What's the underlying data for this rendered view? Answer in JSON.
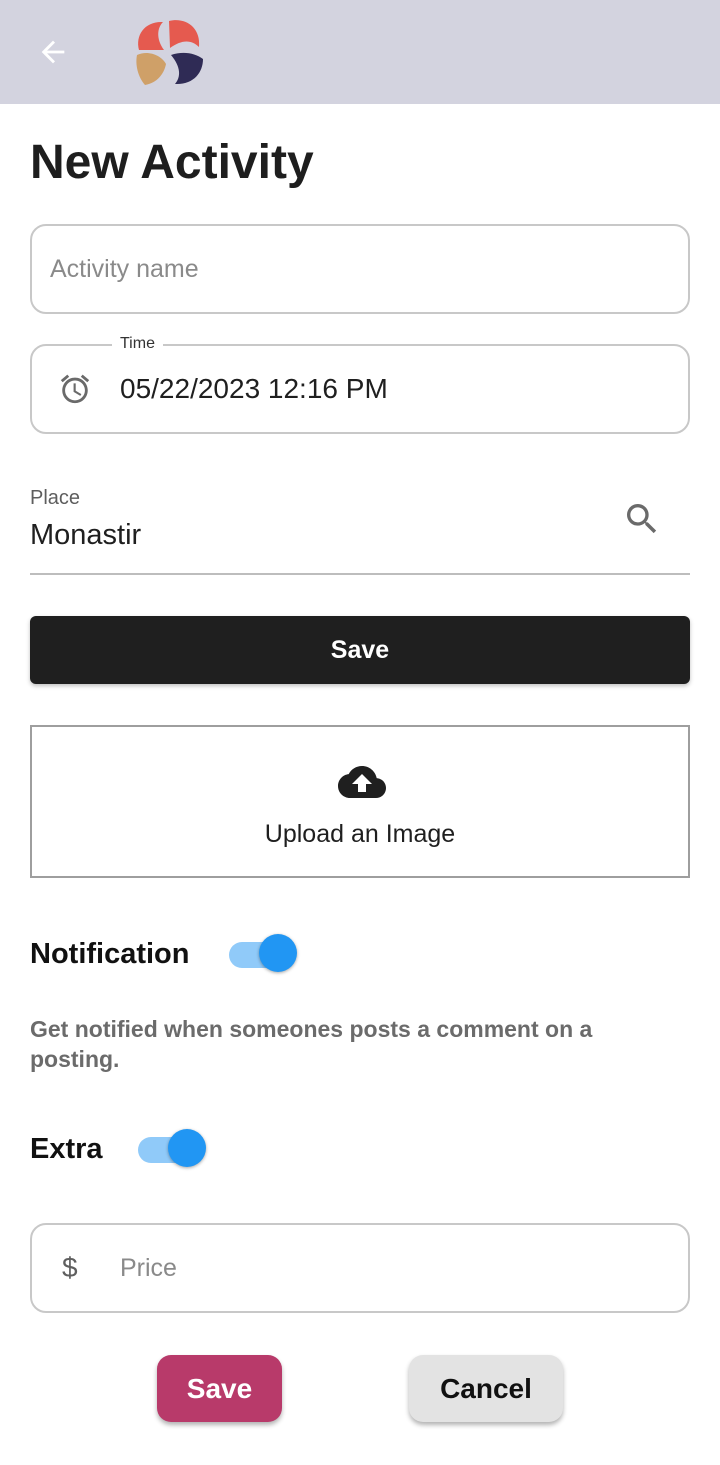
{
  "appbar": {
    "back_icon": "arrow-left-icon",
    "logo": "brand-logo",
    "background": "#d3d3df"
  },
  "page": {
    "title": "New Activity"
  },
  "form": {
    "activity_name": {
      "value": "",
      "placeholder": "Activity name"
    },
    "time": {
      "label": "Time",
      "value": "05/22/2023 12:16 PM",
      "icon": "alarm-clock-icon"
    },
    "place": {
      "label": "Place",
      "value": "Monastir",
      "icon": "search-icon"
    },
    "save_dark_label": "Save",
    "upload": {
      "label": "Upload an Image",
      "icon": "cloud-upload-icon"
    },
    "notification": {
      "label": "Notification",
      "enabled": true,
      "description": "Get notified when someones posts a comment on a posting."
    },
    "extra": {
      "label": "Extra",
      "enabled": true
    },
    "price": {
      "value": "",
      "placeholder": "Price",
      "icon_glyph": "$"
    }
  },
  "actions": {
    "save_label": "Save",
    "cancel_label": "Cancel"
  },
  "colors": {
    "primary_dark": "#1f1f1f",
    "accent_save": "#b83a6a",
    "switch_thumb": "#2196f3",
    "switch_track": "#90caf9"
  }
}
